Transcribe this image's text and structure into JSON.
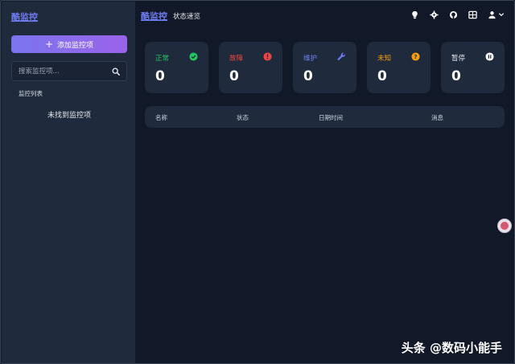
{
  "sidebar": {
    "logo": "酷监控",
    "add_button_label": "添加监控项",
    "search_placeholder": "搜索监控项...",
    "list_title": "监控列表",
    "empty_text": "未找到监控项"
  },
  "header": {
    "title": "酷监控",
    "subtitle": "状态速览",
    "icons": [
      "lightbulb-icon",
      "gear-icon",
      "github-icon",
      "grid-icon",
      "user-icon",
      "chevron-down-icon"
    ]
  },
  "status_cards": [
    {
      "label": "正常",
      "value": "0",
      "color": "#22c55e",
      "icon": "check-circle-icon"
    },
    {
      "label": "故障",
      "value": "0",
      "color": "#ef4444",
      "icon": "alert-circle-icon"
    },
    {
      "label": "维护",
      "value": "0",
      "color": "#6f7cf0",
      "icon": "wrench-icon"
    },
    {
      "label": "未知",
      "value": "0",
      "color": "#f59e0b",
      "icon": "question-circle-icon"
    },
    {
      "label": "暂停",
      "value": "0",
      "color": "#e6e9ef",
      "icon": "pause-circle-icon"
    }
  ],
  "table": {
    "columns": [
      "名称",
      "状态",
      "日期时间",
      "消息"
    ]
  },
  "watermark": "头条 @数码小能手",
  "colors": {
    "background": "#111827",
    "panel": "#1f2a3c",
    "accent": "#6f7cf0"
  }
}
